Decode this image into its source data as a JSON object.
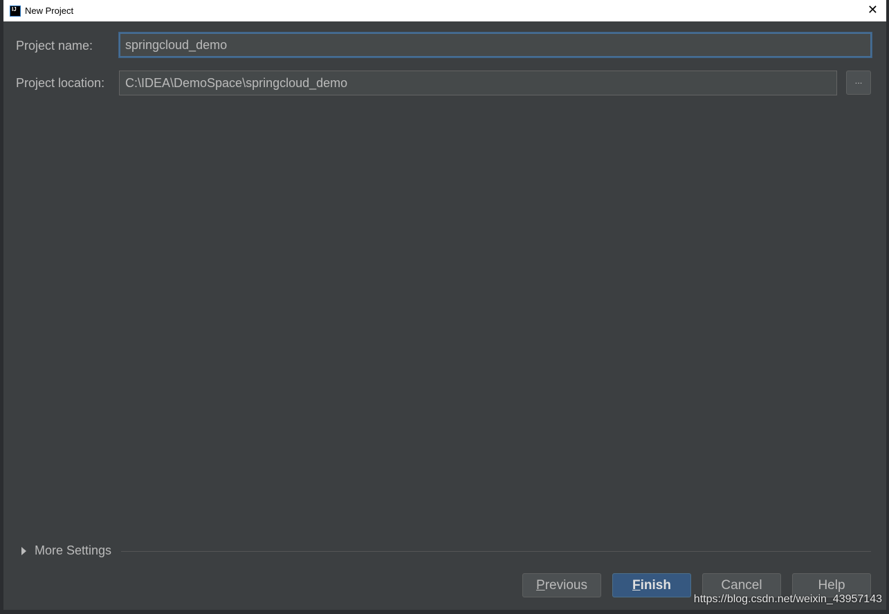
{
  "window": {
    "title": "New Project",
    "icon": "intellij-idea-logo",
    "logo_text": "IJ"
  },
  "form": {
    "project_name_label": "Project name:",
    "project_name_value": "springcloud_demo",
    "project_location_label": "Project location:",
    "project_location_value": "C:\\IDEA\\DemoSpace\\springcloud_demo",
    "browse_label": "..."
  },
  "more_settings": {
    "label": "More Settings",
    "expanded": false
  },
  "buttons": {
    "previous": {
      "mnemonic": "P",
      "rest": "revious"
    },
    "finish": {
      "mnemonic": "F",
      "rest": "inish"
    },
    "cancel": "Cancel",
    "help": "Help"
  },
  "watermark": "https://blog.csdn.net/weixin_43957143",
  "colors": {
    "accent": "#365880",
    "background": "#3c3f41"
  }
}
